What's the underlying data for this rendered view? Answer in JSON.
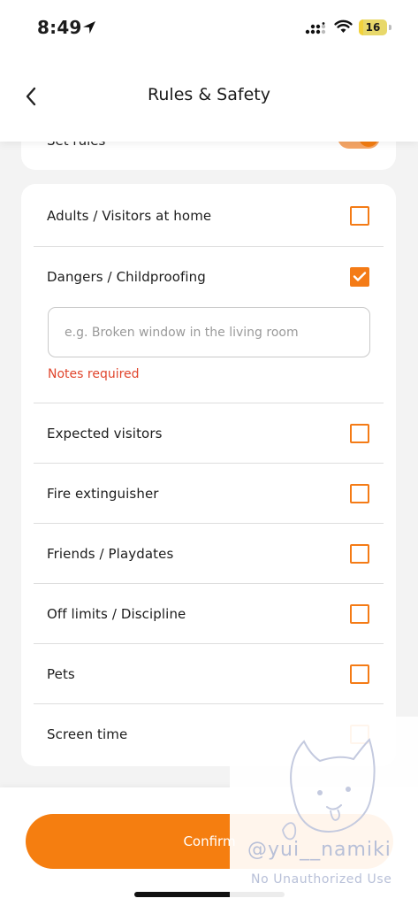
{
  "status_bar": {
    "time": "8:49",
    "battery_level": "16",
    "battery_fraction": 0.16,
    "icons": [
      "location-arrow-icon",
      "cellular-signal-icon",
      "wifi-icon",
      "battery-icon"
    ]
  },
  "header": {
    "title": "Rules & Safety",
    "back_icon": "chevron-left-icon"
  },
  "top_card": {
    "label": "Set rules",
    "toggle_on": true
  },
  "rules": {
    "items": [
      {
        "label": "Adults / Visitors at home",
        "checked": false
      },
      {
        "label": "Dangers / Childproofing",
        "checked": true
      },
      {
        "label": "Expected visitors",
        "checked": false
      },
      {
        "label": "Fire extinguisher",
        "checked": false
      },
      {
        "label": "Friends / Playdates",
        "checked": false
      },
      {
        "label": "Off limits / Discipline",
        "checked": false
      },
      {
        "label": "Pets",
        "checked": false
      },
      {
        "label": "Screen time",
        "checked": false
      }
    ],
    "notes_placeholder": "e.g. Broken window in the living room",
    "notes_value": "",
    "notes_error": "Notes required"
  },
  "footer": {
    "confirm_label": "Confirm"
  },
  "watermark": {
    "handle": "@yui__namiki",
    "notice": "No Unauthorized Use"
  },
  "colors": {
    "accent": "#f57e10",
    "error": "#e0452c",
    "background": "#f3f3f3",
    "card": "#ffffff"
  }
}
